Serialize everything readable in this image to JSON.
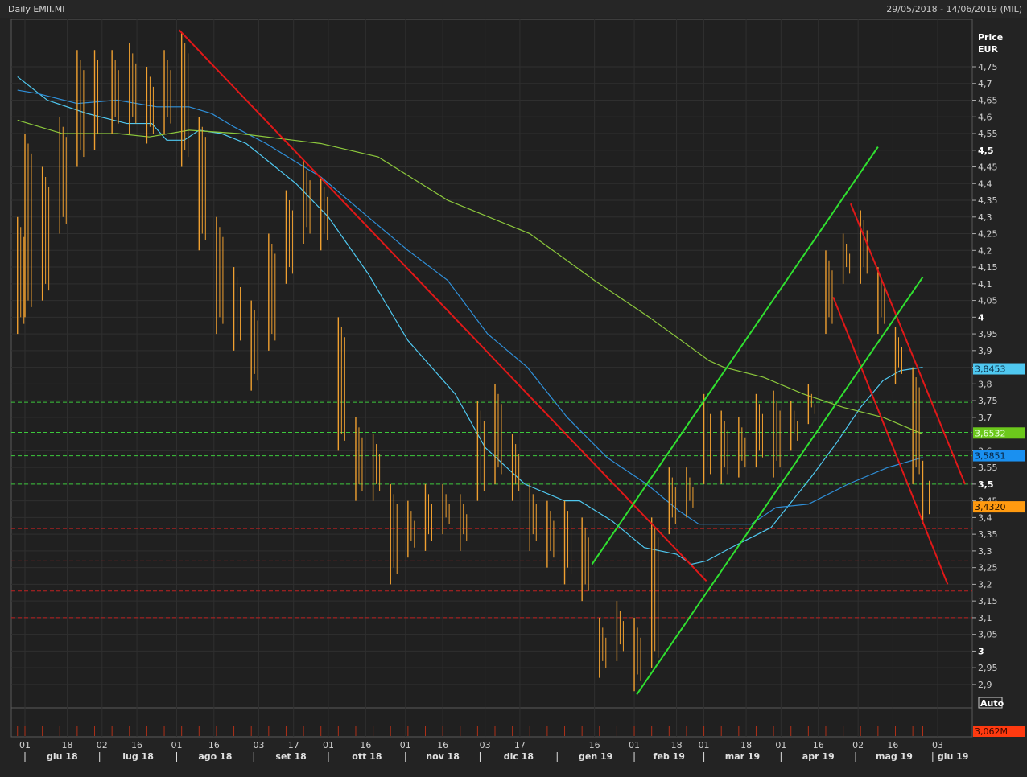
{
  "header": {
    "title": "Daily EMII.MI",
    "range": "29/05/2018 - 14/06/2019 (MIL)"
  },
  "chart_data": {
    "type": "ohlc",
    "title": "Daily EMII.MI",
    "ylabel": "Price",
    "yunit": "EUR",
    "ylim": [
      2.85,
      4.87
    ],
    "xlim": [
      "2018-05-29",
      "2019-06-14"
    ],
    "grid": true,
    "price_color": "#f0a030",
    "yticks": [
      "4,75",
      "4,7",
      "4,65",
      "4,6",
      "4,55",
      "4,5",
      "4,45",
      "4,4",
      "4,35",
      "4,3",
      "4,25",
      "4,2",
      "4,15",
      "4,1",
      "4,05",
      "4",
      "3,95",
      "3,9",
      "3,85",
      "3,8",
      "3,75",
      "3,7",
      "3,65",
      "3,6",
      "3,55",
      "3,5",
      "3,45",
      "3,4",
      "3,35",
      "3,3",
      "3,25",
      "3,2",
      "3,15",
      "3,1",
      "3,05",
      "3",
      "2,95",
      "2,9"
    ],
    "ytick_values": [
      4.75,
      4.7,
      4.65,
      4.6,
      4.55,
      4.5,
      4.45,
      4.4,
      4.35,
      4.3,
      4.25,
      4.2,
      4.15,
      4.1,
      4.05,
      4,
      3.95,
      3.9,
      3.85,
      3.8,
      3.75,
      3.7,
      3.65,
      3.6,
      3.55,
      3.5,
      3.45,
      3.4,
      3.35,
      3.3,
      3.25,
      3.2,
      3.15,
      3.1,
      3.05,
      3,
      2.95,
      2.9
    ],
    "yticks_bold": [
      "4,5",
      "4",
      "3,5",
      "3"
    ],
    "xticks": [
      {
        "date": "2018-06-01",
        "label": "01"
      },
      {
        "date": "2018-06-18",
        "label": "18"
      },
      {
        "date": "2018-07-02",
        "label": "02"
      },
      {
        "date": "2018-07-16",
        "label": "16"
      },
      {
        "date": "2018-08-01",
        "label": "01"
      },
      {
        "date": "2018-08-16",
        "label": "16"
      },
      {
        "date": "2018-09-03",
        "label": "03"
      },
      {
        "date": "2018-09-17",
        "label": "17"
      },
      {
        "date": "2018-10-01",
        "label": "01"
      },
      {
        "date": "2018-10-16",
        "label": "16"
      },
      {
        "date": "2018-11-01",
        "label": "01"
      },
      {
        "date": "2018-11-16",
        "label": "16"
      },
      {
        "date": "2018-12-03",
        "label": "03"
      },
      {
        "date": "2018-12-17",
        "label": "17"
      },
      {
        "date": "2019-01-16",
        "label": "16"
      },
      {
        "date": "2019-02-01",
        "label": "01"
      },
      {
        "date": "2019-02-18",
        "label": "18"
      },
      {
        "date": "2019-03-01",
        "label": "01"
      },
      {
        "date": "2019-03-18",
        "label": "18"
      },
      {
        "date": "2019-04-01",
        "label": "01"
      },
      {
        "date": "2019-04-16",
        "label": "16"
      },
      {
        "date": "2019-05-02",
        "label": "02"
      },
      {
        "date": "2019-05-16",
        "label": "16"
      },
      {
        "date": "2019-06-03",
        "label": "03"
      }
    ],
    "months": [
      {
        "start": "2018-06-01",
        "label": "giu 18"
      },
      {
        "start": "2018-07-01",
        "label": "lug 18"
      },
      {
        "start": "2018-08-01",
        "label": "ago 18"
      },
      {
        "start": "2018-09-01",
        "label": "set 18"
      },
      {
        "start": "2018-10-01",
        "label": "ott 18"
      },
      {
        "start": "2018-11-01",
        "label": "nov 18"
      },
      {
        "start": "2018-12-01",
        "label": "dic 18"
      },
      {
        "start": "2019-01-01",
        "label": "gen 19"
      },
      {
        "start": "2019-02-01",
        "label": "feb 19"
      },
      {
        "start": "2019-03-01",
        "label": "mar 19"
      },
      {
        "start": "2019-04-01",
        "label": "apr 19"
      },
      {
        "start": "2019-05-01",
        "label": "mag 19"
      },
      {
        "start": "2019-06-01",
        "label": "giu 19"
      }
    ],
    "bars": [
      [
        "2018-05-29",
        4.3,
        3.95
      ],
      [
        "2018-06-01",
        4.55,
        4.0
      ],
      [
        "2018-06-08",
        4.45,
        4.05
      ],
      [
        "2018-06-15",
        4.6,
        4.25
      ],
      [
        "2018-06-22",
        4.8,
        4.45
      ],
      [
        "2018-06-29",
        4.8,
        4.5
      ],
      [
        "2018-07-06",
        4.8,
        4.55
      ],
      [
        "2018-07-13",
        4.82,
        4.55
      ],
      [
        "2018-07-20",
        4.75,
        4.52
      ],
      [
        "2018-07-27",
        4.8,
        4.55
      ],
      [
        "2018-08-03",
        4.85,
        4.45
      ],
      [
        "2018-08-10",
        4.6,
        4.2
      ],
      [
        "2018-08-17",
        4.3,
        3.95
      ],
      [
        "2018-08-24",
        4.15,
        3.9
      ],
      [
        "2018-08-31",
        4.05,
        3.78
      ],
      [
        "2018-09-07",
        4.25,
        3.9
      ],
      [
        "2018-09-14",
        4.38,
        4.1
      ],
      [
        "2018-09-21",
        4.47,
        4.22
      ],
      [
        "2018-09-28",
        4.42,
        4.2
      ],
      [
        "2018-10-05",
        4.0,
        3.6
      ],
      [
        "2018-10-12",
        3.7,
        3.45
      ],
      [
        "2018-10-19",
        3.65,
        3.45
      ],
      [
        "2018-10-26",
        3.5,
        3.2
      ],
      [
        "2018-11-02",
        3.45,
        3.28
      ],
      [
        "2018-11-09",
        3.5,
        3.3
      ],
      [
        "2018-11-16",
        3.5,
        3.35
      ],
      [
        "2018-11-23",
        3.47,
        3.3
      ],
      [
        "2018-11-30",
        3.75,
        3.45
      ],
      [
        "2018-12-07",
        3.8,
        3.5
      ],
      [
        "2018-12-14",
        3.65,
        3.45
      ],
      [
        "2018-12-21",
        3.5,
        3.3
      ],
      [
        "2018-12-28",
        3.45,
        3.25
      ],
      [
        "2019-01-04",
        3.45,
        3.2
      ],
      [
        "2019-01-11",
        3.4,
        3.15
      ],
      [
        "2019-01-18",
        3.1,
        2.92
      ],
      [
        "2019-01-25",
        3.15,
        2.97
      ],
      [
        "2019-02-01",
        3.1,
        2.88
      ],
      [
        "2019-02-08",
        3.4,
        2.95
      ],
      [
        "2019-02-15",
        3.55,
        3.35
      ],
      [
        "2019-02-22",
        3.55,
        3.4
      ],
      [
        "2019-03-01",
        3.77,
        3.5
      ],
      [
        "2019-03-08",
        3.72,
        3.5
      ],
      [
        "2019-03-15",
        3.7,
        3.52
      ],
      [
        "2019-03-22",
        3.77,
        3.55
      ],
      [
        "2019-03-29",
        3.78,
        3.52
      ],
      [
        "2019-04-05",
        3.75,
        3.6
      ],
      [
        "2019-04-12",
        3.8,
        3.68
      ],
      [
        "2019-04-19",
        4.2,
        3.95
      ],
      [
        "2019-04-26",
        4.25,
        4.1
      ],
      [
        "2019-05-03",
        4.32,
        4.1
      ],
      [
        "2019-05-10",
        4.15,
        3.95
      ],
      [
        "2019-05-17",
        3.97,
        3.8
      ],
      [
        "2019-05-24",
        3.85,
        3.5
      ],
      [
        "2019-05-28",
        3.57,
        3.38
      ]
    ],
    "series": [
      {
        "color": "#4fc8f0",
        "last_label": "3,8453",
        "points": [
          [
            "2018-05-29",
            4.72
          ],
          [
            "2018-06-10",
            4.65
          ],
          [
            "2018-06-26",
            4.61
          ],
          [
            "2018-07-12",
            4.58
          ],
          [
            "2018-07-22",
            4.58
          ],
          [
            "2018-07-28",
            4.53
          ],
          [
            "2018-08-04",
            4.53
          ],
          [
            "2018-08-10",
            4.56
          ],
          [
            "2018-08-19",
            4.55
          ],
          [
            "2018-08-29",
            4.52
          ],
          [
            "2018-09-08",
            4.46
          ],
          [
            "2018-09-18",
            4.4
          ],
          [
            "2018-10-01",
            4.3
          ],
          [
            "2018-10-17",
            4.13
          ],
          [
            "2018-11-02",
            3.93
          ],
          [
            "2018-11-21",
            3.77
          ],
          [
            "2018-12-03",
            3.61
          ],
          [
            "2018-12-19",
            3.5
          ],
          [
            "2019-01-04",
            3.45
          ],
          [
            "2019-01-10",
            3.45
          ],
          [
            "2019-01-23",
            3.39
          ],
          [
            "2019-02-05",
            3.31
          ],
          [
            "2019-02-18",
            3.29
          ],
          [
            "2019-02-24",
            3.26
          ],
          [
            "2019-03-02",
            3.27
          ],
          [
            "2019-03-12",
            3.31
          ],
          [
            "2019-03-28",
            3.37
          ],
          [
            "2019-04-13",
            3.52
          ],
          [
            "2019-04-23",
            3.62
          ],
          [
            "2019-05-03",
            3.73
          ],
          [
            "2019-05-12",
            3.81
          ],
          [
            "2019-05-19",
            3.84
          ],
          [
            "2019-05-28",
            3.85
          ]
        ]
      },
      {
        "color": "#2f8fd8",
        "last_label": "3,5851",
        "points": [
          [
            "2018-05-29",
            4.68
          ],
          [
            "2018-06-06",
            4.67
          ],
          [
            "2018-06-22",
            4.64
          ],
          [
            "2018-07-08",
            4.65
          ],
          [
            "2018-07-24",
            4.63
          ],
          [
            "2018-08-06",
            4.63
          ],
          [
            "2018-08-15",
            4.61
          ],
          [
            "2018-08-24",
            4.57
          ],
          [
            "2018-09-06",
            4.52
          ],
          [
            "2018-09-19",
            4.46
          ],
          [
            "2018-09-28",
            4.42
          ],
          [
            "2018-10-17",
            4.3
          ],
          [
            "2018-11-02",
            4.2
          ],
          [
            "2018-11-18",
            4.11
          ],
          [
            "2018-12-04",
            3.95
          ],
          [
            "2018-12-20",
            3.85
          ],
          [
            "2019-01-05",
            3.7
          ],
          [
            "2019-01-21",
            3.58
          ],
          [
            "2019-02-06",
            3.5
          ],
          [
            "2019-02-19",
            3.42
          ],
          [
            "2019-02-27",
            3.38
          ],
          [
            "2019-03-20",
            3.38
          ],
          [
            "2019-03-30",
            3.43
          ],
          [
            "2019-04-12",
            3.44
          ],
          [
            "2019-04-28",
            3.5
          ],
          [
            "2019-05-14",
            3.55
          ],
          [
            "2019-05-28",
            3.58
          ]
        ]
      },
      {
        "color": "#8cc83c",
        "last_label": "3,6532",
        "points": [
          [
            "2018-05-29",
            4.59
          ],
          [
            "2018-06-16",
            4.55
          ],
          [
            "2018-07-08",
            4.55
          ],
          [
            "2018-07-21",
            4.54
          ],
          [
            "2018-08-06",
            4.56
          ],
          [
            "2018-08-26",
            4.55
          ],
          [
            "2018-09-28",
            4.52
          ],
          [
            "2018-10-21",
            4.48
          ],
          [
            "2018-11-18",
            4.35
          ],
          [
            "2018-12-21",
            4.25
          ],
          [
            "2019-01-16",
            4.11
          ],
          [
            "2019-02-07",
            4.0
          ],
          [
            "2019-03-03",
            3.87
          ],
          [
            "2019-03-09",
            3.85
          ],
          [
            "2019-03-25",
            3.82
          ],
          [
            "2019-04-10",
            3.77
          ],
          [
            "2019-04-26",
            3.73
          ],
          [
            "2019-05-12",
            3.7
          ],
          [
            "2019-05-28",
            3.65
          ]
        ]
      }
    ],
    "trendlines": [
      {
        "color": "#e01818",
        "from": [
          "2018-08-02",
          4.86
        ],
        "to": [
          "2019-03-02",
          3.21
        ]
      },
      {
        "color": "#e01818",
        "from": [
          "2019-04-29",
          4.34
        ],
        "to": [
          "2019-06-14",
          3.5
        ]
      },
      {
        "color": "#e01818",
        "from": [
          "2019-04-22",
          4.06
        ],
        "to": [
          "2019-06-07",
          3.2
        ]
      },
      {
        "color": "#30e030",
        "from": [
          "2019-01-15",
          3.26
        ],
        "to": [
          "2019-05-10",
          4.51
        ]
      },
      {
        "color": "#30e030",
        "from": [
          "2019-02-02",
          2.87
        ],
        "to": [
          "2019-05-28",
          4.12
        ]
      }
    ],
    "levels": [
      {
        "value": 3.745,
        "color": "#3cc83c"
      },
      {
        "value": 3.655,
        "color": "#3cc83c"
      },
      {
        "value": 3.585,
        "color": "#3cc83c"
      },
      {
        "value": 3.5,
        "color": "#3cc83c"
      },
      {
        "value": 3.367,
        "color": "#c02020"
      },
      {
        "value": 3.27,
        "color": "#c02020"
      },
      {
        "value": 3.18,
        "color": "#c02020"
      },
      {
        "value": 3.1,
        "color": "#c02020"
      }
    ],
    "last_price": {
      "value": 3.432,
      "label": "3,4320",
      "color": "#ff9a10"
    },
    "volume": {
      "last_label": "3,062M",
      "color": "#ff3a10",
      "bar_color": "#b03018"
    },
    "scale_button": "Auto"
  }
}
